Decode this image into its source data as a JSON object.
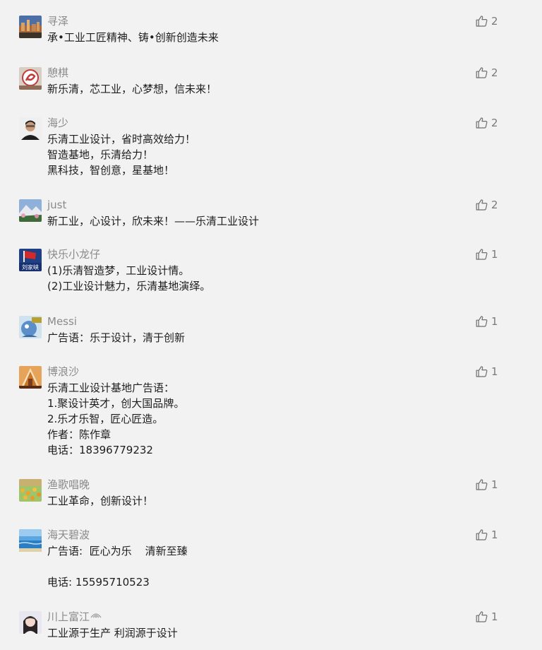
{
  "comments": [
    {
      "name": "寻泽",
      "likes": "2",
      "avatar_icon": "cityscape-avatar-icon",
      "lines": [
        "承•工业工匠精神、铸•创新创造未来"
      ]
    },
    {
      "name": "憩棋",
      "likes": "2",
      "avatar_icon": "seal-stamp-avatar-icon",
      "lines": [
        "新乐清，芯工业，心梦想，信未来！"
      ]
    },
    {
      "name": "海少",
      "likes": "2",
      "avatar_icon": "person-portrait-avatar-icon",
      "lines": [
        "乐清工业设计，省时高效给力！",
        "智造基地，乐清给力！",
        "黑科技，智创意，星基地！"
      ]
    },
    {
      "name": "just",
      "likes": "2",
      "avatar_icon": "mountain-landscape-avatar-icon",
      "lines": [
        "新工业，心设计，欣未来！——乐清工业设计"
      ]
    },
    {
      "name": "快乐小龙仔",
      "likes": "1",
      "avatar_icon": "flag-avatar-icon",
      "avatar_text": "刘家峡",
      "lines": [
        "(1)乐清智造梦，工业设计情。",
        "(2)工业设计魅力，乐清基地演绎。"
      ]
    },
    {
      "name": "Messi",
      "likes": "1",
      "avatar_icon": "cartoon-avatar-icon",
      "lines": [
        "广告语：乐于设计，清于创新"
      ]
    },
    {
      "name": "博浪沙",
      "likes": "1",
      "avatar_icon": "temple-avatar-icon",
      "lines": [
        "乐清工业设计基地广告语：",
        "1.聚设计英才，创大国品牌。",
        "2.乐才乐智，匠心匠造。",
        "作者：陈作章",
        "电话：18396779232"
      ]
    },
    {
      "name": "渔歌唱晚",
      "likes": "1",
      "avatar_icon": "flower-field-avatar-icon",
      "lines": [
        "工业革命，创新设计！"
      ]
    },
    {
      "name": "海天碧波",
      "likes": "1",
      "avatar_icon": "seascape-avatar-icon",
      "lines": [
        "广告语:  匠心为乐    清新至臻",
        "",
        "电话: 15595710523"
      ]
    },
    {
      "name": "川上富江",
      "likes": "1",
      "avatar_icon": "girl-portrait-avatar-icon",
      "name_icon": "wifi-signal-icon",
      "lines": [
        "工业源于生产 利润源于设计"
      ]
    }
  ],
  "colors": {
    "background": "#f2f2f2",
    "name": "#8a8a8a",
    "text": "#1d1d1d",
    "like": "#7a7a7a"
  }
}
